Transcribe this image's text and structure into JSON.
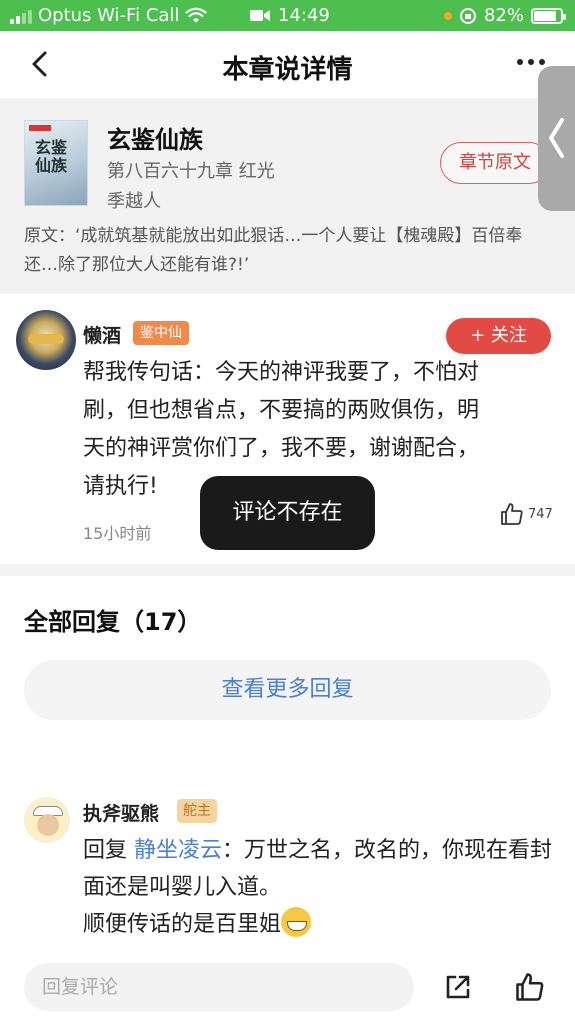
{
  "status_bar": {
    "carrier": "Optus Wi-Fi Call",
    "time": "14:49",
    "battery": "82%",
    "bg_color": "#4cbf4e"
  },
  "nav": {
    "title": "本章说详情",
    "back_icon": "chevron-left-icon",
    "more_icon": "more-dots-icon"
  },
  "book": {
    "title": "玄鉴仙族",
    "chapter": "第八百六十九章 红光",
    "author": "季越人",
    "cover_text": "玄鉴仙族",
    "original_button": "章节原文",
    "quote": "原文：‘成就筑基就能放出如此狠话…一个人要让【槐魂殿】百倍奉还…除了那位大人还能有谁?!’"
  },
  "comment": {
    "username": "懒酒",
    "badge": "鉴中仙",
    "follow_label": "+ 关注",
    "text": "帮我传句话：今天的神评我要了，不怕对刷，但也想省点，不要搞的两败俱伤，明天的神评赏你们了，我不要，谢谢配合，请执行!",
    "time": "15小时前",
    "likes": "747"
  },
  "toast": "评论不存在",
  "replies": {
    "header": "全部回复（17）",
    "more_button": "查看更多回复",
    "items": [
      {
        "username": "执斧驱熊",
        "badge": "舵主",
        "prefix": "回复 ",
        "mention": "静坐凌云",
        "text_1": "：万世之名，改名的，你现在看封面还是叫婴儿入道。",
        "text_2": "顺便传话的是百里姐"
      }
    ]
  },
  "bottom_bar": {
    "input_placeholder": "回复评论",
    "share_icon": "share-icon",
    "like_icon": "thumbs-up-icon"
  }
}
